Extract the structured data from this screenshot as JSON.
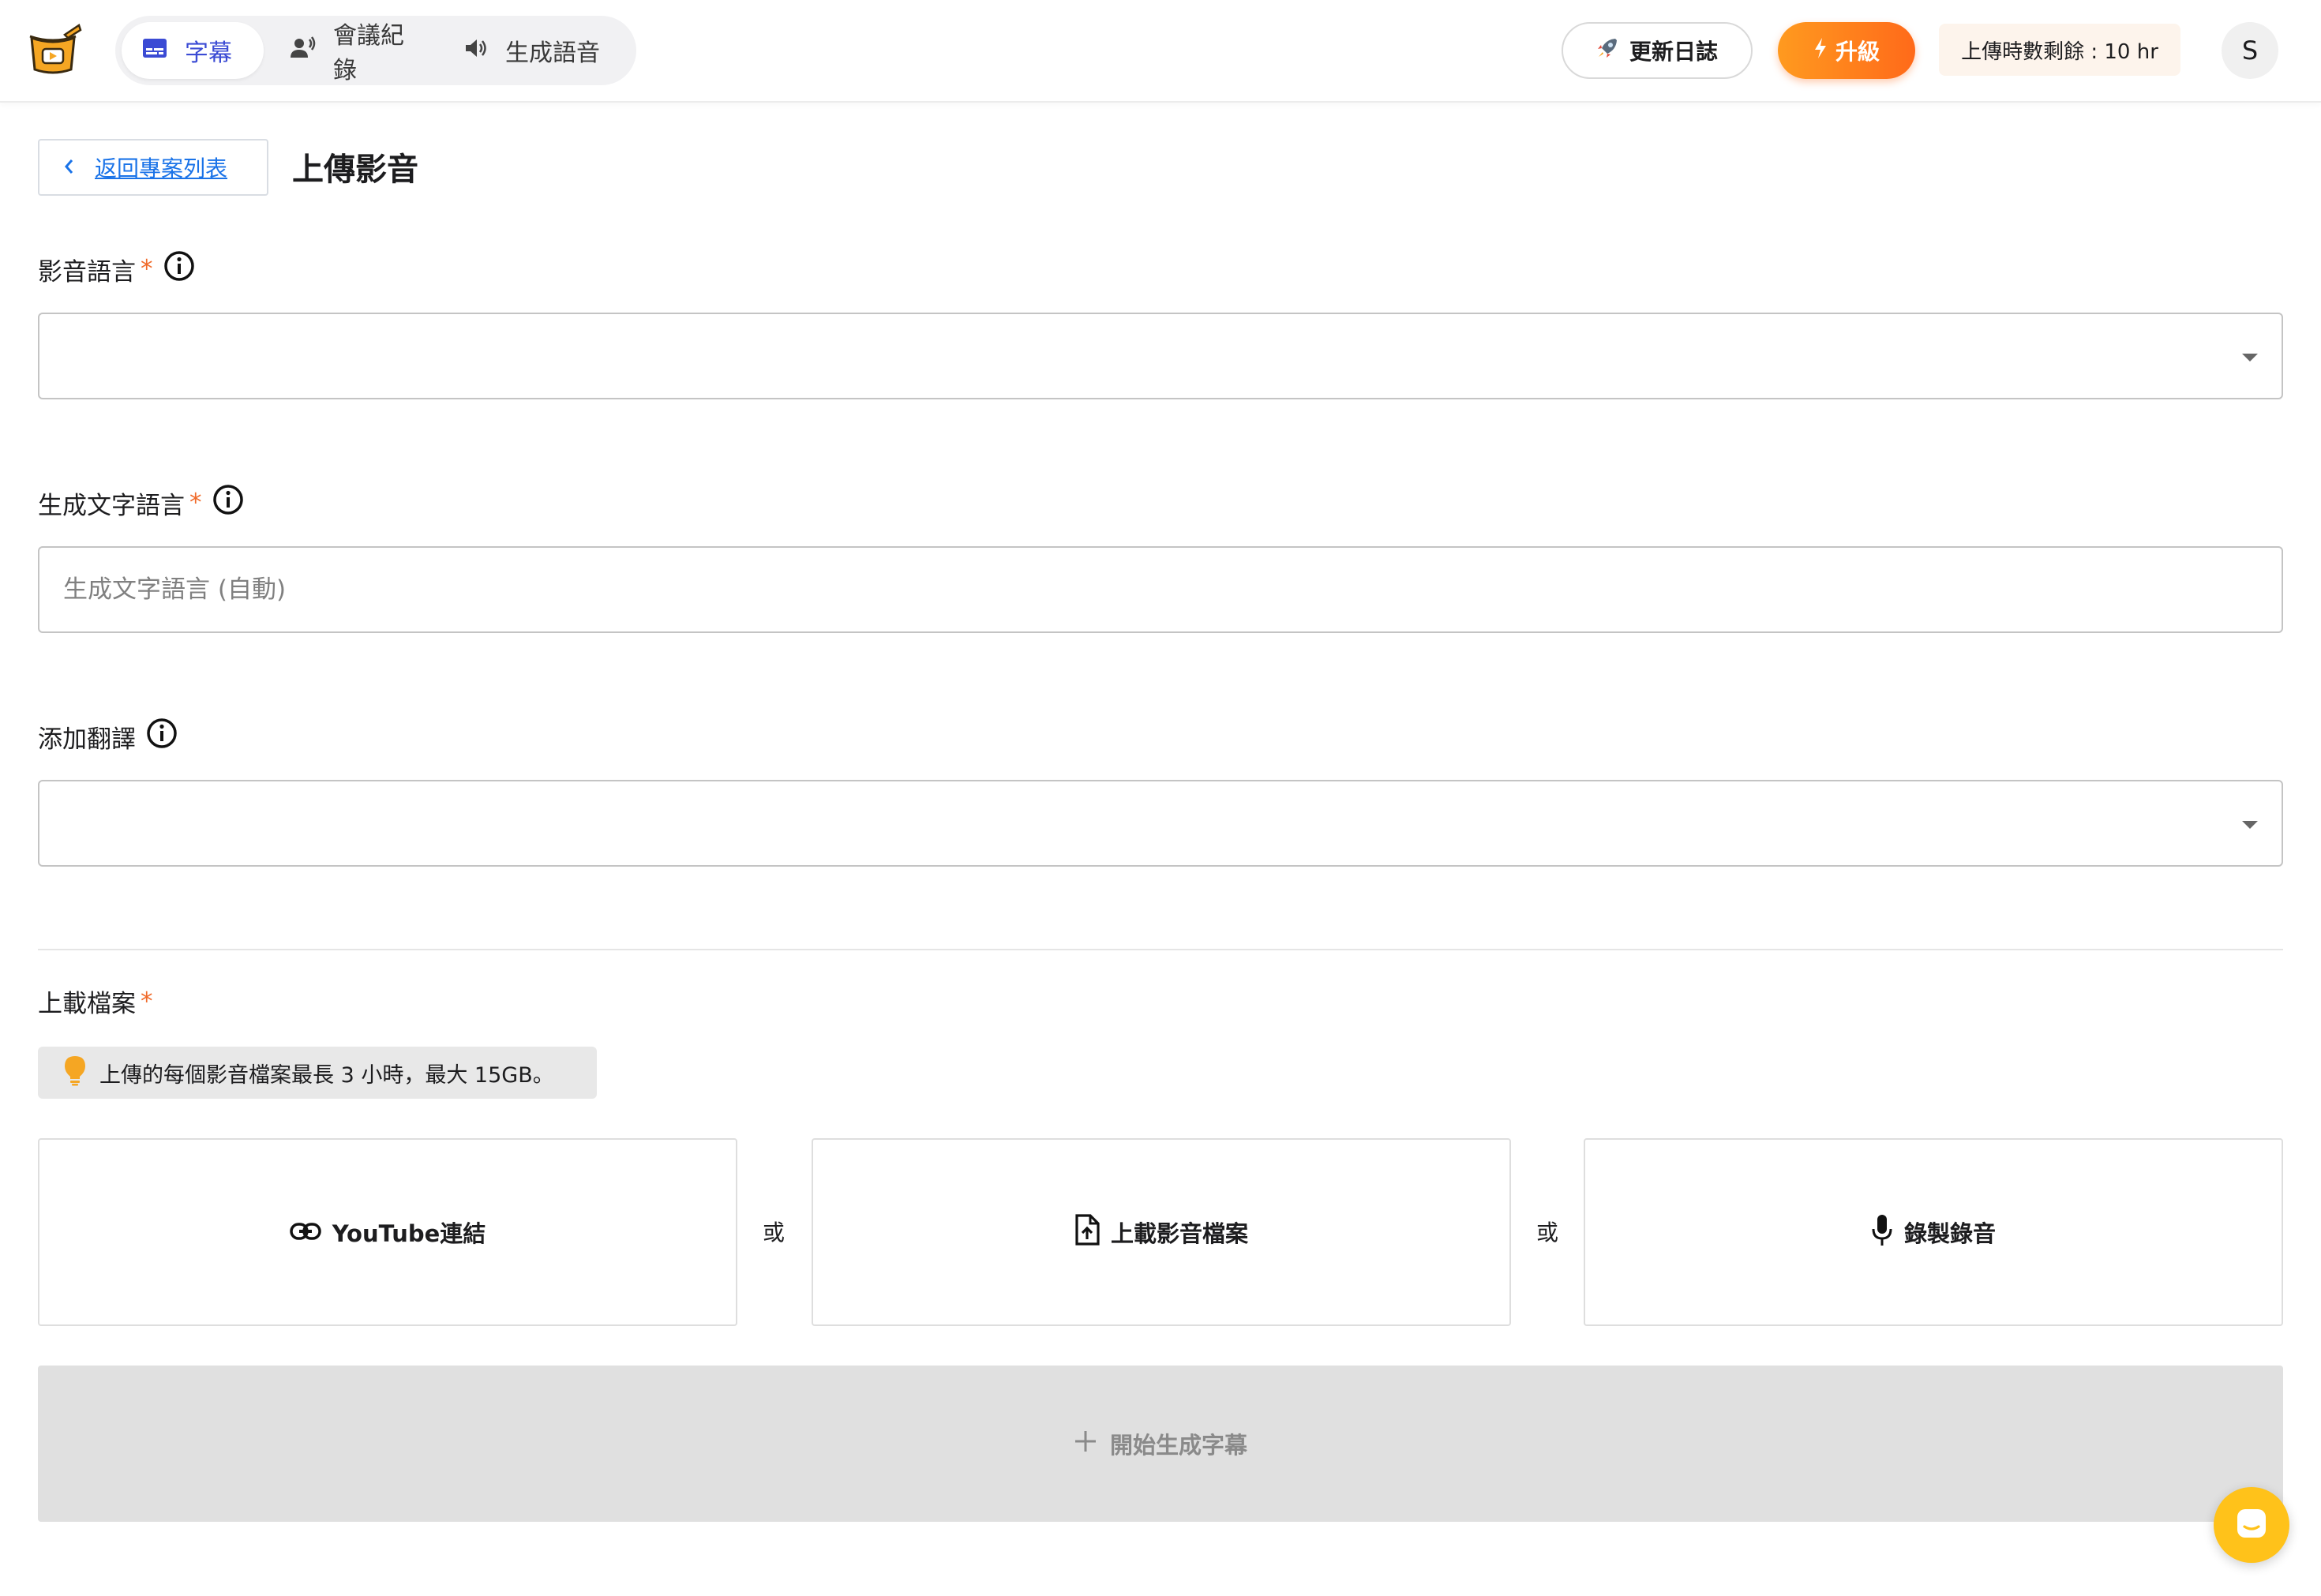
{
  "header": {
    "tabs": [
      {
        "label": "字幕",
        "icon": "subtitles-icon",
        "active": true
      },
      {
        "label": "會議紀錄",
        "icon": "speaker-person-icon",
        "active": false
      },
      {
        "label": "生成語音",
        "icon": "volume-icon",
        "active": false
      }
    ],
    "changelog_label": "更新日誌",
    "upgrade_label": "升級",
    "quota_text": "上傳時數剩餘 : 10 hr",
    "avatar_initial": "S"
  },
  "page": {
    "back_label": "返回專案列表",
    "title": "上傳影音"
  },
  "form": {
    "media_language": {
      "label": "影音語言",
      "required_mark": "*",
      "value": ""
    },
    "text_language": {
      "label": "生成文字語言",
      "required_mark": "*",
      "placeholder": "生成文字語言 (自動)"
    },
    "translation": {
      "label": "添加翻譯",
      "value": ""
    },
    "upload": {
      "label": "上載檔案",
      "required_mark": "*",
      "tip": "上傳的每個影音檔案最長 3 小時，最大 15GB。",
      "youtube_label": "YouTube連結",
      "file_label": "上載影音檔案",
      "record_label": "錄製錄音",
      "or_text": "或"
    },
    "submit_label": "開始生成字幕"
  },
  "colors": {
    "accent": "#3b4bd4",
    "upgrade": "#ff7a1a",
    "required": "#f06a2a",
    "link": "#1a73e8",
    "chat_fab": "#ffc21a"
  }
}
